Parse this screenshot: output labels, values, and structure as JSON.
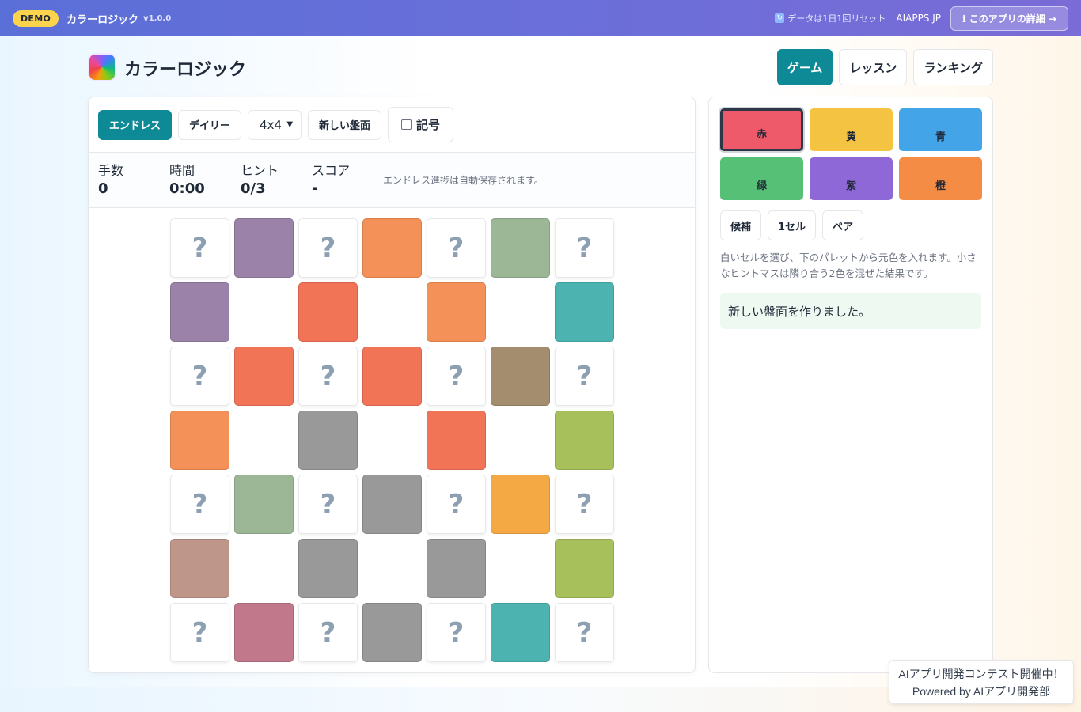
{
  "topbar": {
    "badge": "DEMO",
    "app_name": "カラーロジック",
    "version": "v1.0.0",
    "reset_note": "データは1日1回リセット",
    "site": "AIAPPS.JP",
    "detail_button": "ℹ このアプリの詳細 →"
  },
  "header": {
    "title": "カラーロジック",
    "tabs": [
      {
        "label": "ゲーム",
        "active": true
      },
      {
        "label": "レッスン",
        "active": false
      },
      {
        "label": "ランキング",
        "active": false
      }
    ]
  },
  "toolbar": {
    "endless": "エンドレス",
    "daily": "デイリー",
    "size": "4x4",
    "new_board": "新しい盤面",
    "symbols": "記号"
  },
  "stats": {
    "moves_label": "手数",
    "moves": "0",
    "time_label": "時間",
    "time": "0:00",
    "hint_label": "ヒント",
    "hint": "0/3",
    "score_label": "スコア",
    "score": "-",
    "note": "エンドレス進捗は自動保存されます。"
  },
  "board": {
    "unknown_symbol": "?",
    "rows": [
      [
        "?",
        "#9a82a8",
        "?",
        "#f39158",
        "?",
        "#9bb796",
        "?"
      ],
      [
        "#9a82a8",
        "",
        "#f27457",
        "",
        "#f39158",
        "",
        "#4db3b0"
      ],
      [
        "?",
        "#f27457",
        "?",
        "#f27457",
        "?",
        "#a48c6e",
        "?"
      ],
      [
        "#f39158",
        "",
        "#999999",
        "",
        "#f27457",
        "",
        "#a8c05c"
      ],
      [
        "?",
        "#9bb796",
        "?",
        "#999999",
        "?",
        "#f4a944",
        "?"
      ],
      [
        "#bf968a",
        "",
        "#999999",
        "",
        "#999999",
        "",
        "#a8c05c"
      ],
      [
        "?",
        "#c0788a",
        "?",
        "#999999",
        "?",
        "#4db3b0",
        "?"
      ]
    ]
  },
  "palette": [
    {
      "label": "赤",
      "color": "#ef5a6a",
      "selected": true
    },
    {
      "label": "黄",
      "color": "#f5c342",
      "selected": false
    },
    {
      "label": "青",
      "color": "#43a5e8",
      "selected": false
    },
    {
      "label": "緑",
      "color": "#56c076",
      "selected": false
    },
    {
      "label": "紫",
      "color": "#8e68d6",
      "selected": false
    },
    {
      "label": "橙",
      "color": "#f58c45",
      "selected": false
    }
  ],
  "hint_buttons": [
    "候補",
    "1セル",
    "ペア"
  ],
  "instructions": "白いセルを選び、下のパレットから元色を入れます。小さなヒントマスは隣り合う2色を混ぜた結果です。",
  "message": "新しい盤面を作りました。",
  "contest": {
    "line1": "AIアプリ開発コンテスト開催中！",
    "line2": "Powered by AIアプリ開発部"
  }
}
